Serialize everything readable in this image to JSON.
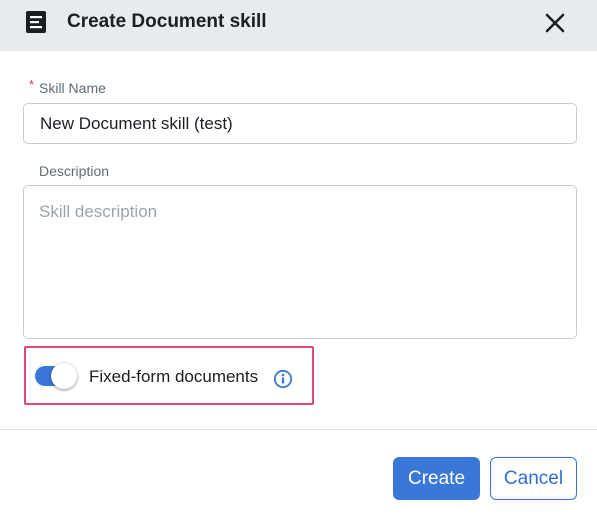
{
  "dialog": {
    "title": "Create Document skill",
    "header_icon": "document-lines-icon",
    "close_icon": "close-icon"
  },
  "form": {
    "skill_name": {
      "required_marker": "*",
      "label": "Skill Name",
      "value": "New Document skill (test)"
    },
    "description": {
      "label": "Description",
      "placeholder": "Skill description",
      "value": ""
    },
    "fixed_form_toggle": {
      "label": "Fixed-form documents",
      "enabled": true,
      "info_icon": "info-icon"
    }
  },
  "footer": {
    "create_label": "Create",
    "cancel_label": "Cancel"
  },
  "colors": {
    "primary": "#3a78d7",
    "highlight_border": "#e0457b",
    "required": "#d6336c",
    "header_bg": "#e8ebee"
  }
}
